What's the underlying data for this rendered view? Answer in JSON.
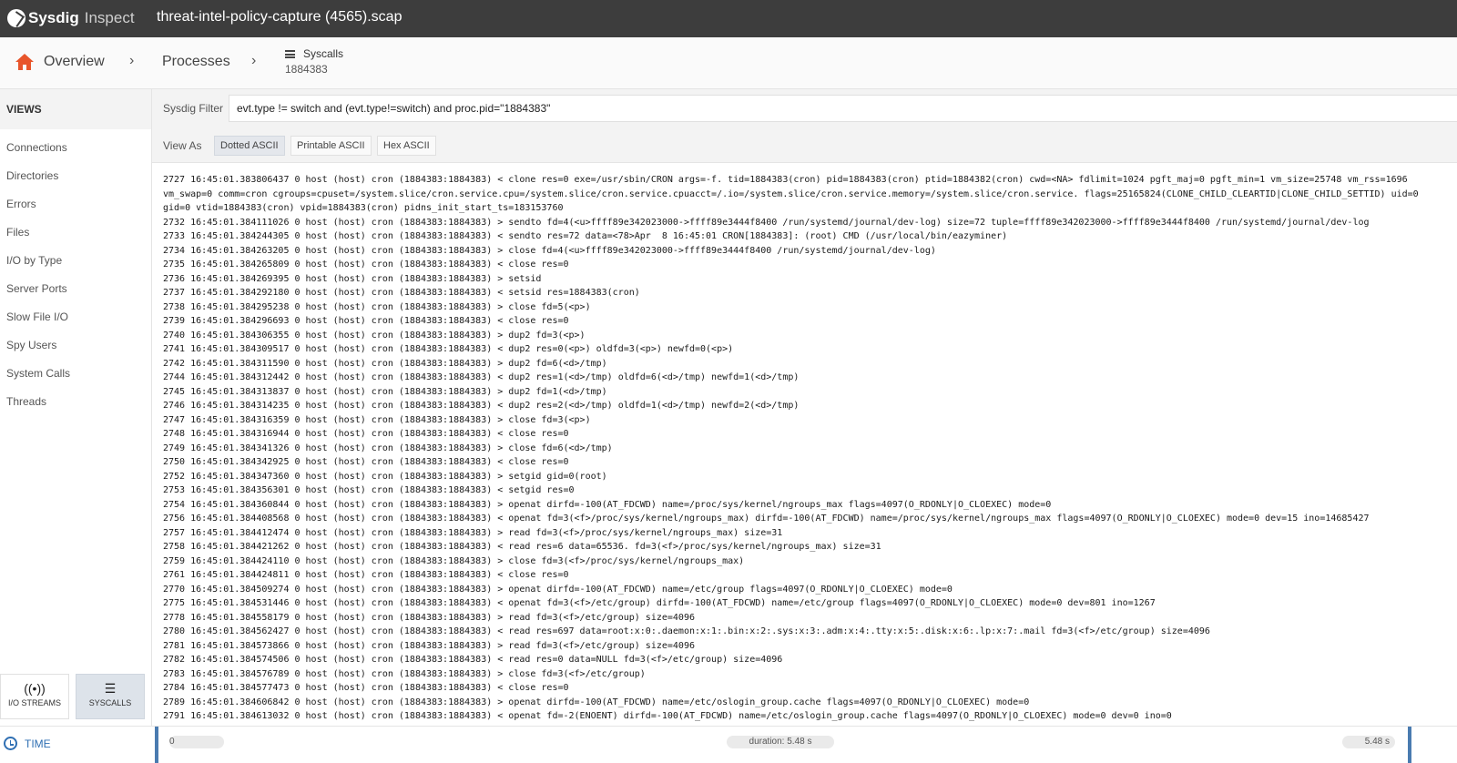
{
  "app": {
    "brand": "Sysdig",
    "product": "Inspect",
    "capture_file": "threat-intel-policy-capture (4565).scap"
  },
  "breadcrumb": {
    "overview": "Overview",
    "processes": "Processes",
    "syscalls": "Syscalls",
    "pid": "1884383"
  },
  "sidebar": {
    "title": "VIEWS",
    "items": [
      "Connections",
      "Directories",
      "Errors",
      "Files",
      "I/O by Type",
      "Server Ports",
      "Slow File I/O",
      "Spy Users",
      "System Calls",
      "Threads"
    ],
    "tabs": [
      {
        "label": "I/O STREAMS",
        "icon": "broadcast-icon"
      },
      {
        "label": "SYSCALLS",
        "icon": "list-icon",
        "active": true
      }
    ]
  },
  "filter": {
    "label": "Sysdig Filter",
    "value": "evt.type != switch and (evt.type!=switch) and proc.pid=\"1884383\""
  },
  "view_as": {
    "label": "View As",
    "options": [
      "Dotted ASCII",
      "Printable ASCII",
      "Hex ASCII"
    ],
    "selected": "Dotted ASCII"
  },
  "log_lines": [
    "2727 16:45:01.383806437 0 host (host) cron (1884383:1884383) < clone res=0 exe=/usr/sbin/CRON args=-f. tid=1884383(cron) pid=1884383(cron) ptid=1884382(cron) cwd=<NA> fdlimit=1024 pgft_maj=0 pgft_min=1 vm_size=25748 vm_rss=1696",
    "vm_swap=0 comm=cron cgroups=cpuset=/system.slice/cron.service.cpu=/system.slice/cron.service.cpuacct=/.io=/system.slice/cron.service.memory=/system.slice/cron.service. flags=25165824(CLONE_CHILD_CLEARTID|CLONE_CHILD_SETTID) uid=0",
    "gid=0 vtid=1884383(cron) vpid=1884383(cron) pidns_init_start_ts=183153760",
    "2732 16:45:01.384111026 0 host (host) cron (1884383:1884383) > sendto fd=4(<u>ffff89e342023000->ffff89e3444f8400 /run/systemd/journal/dev-log) size=72 tuple=ffff89e342023000->ffff89e3444f8400 /run/systemd/journal/dev-log",
    "2733 16:45:01.384244305 0 host (host) cron (1884383:1884383) < sendto res=72 data=<78>Apr  8 16:45:01 CRON[1884383]: (root) CMD (/usr/local/bin/eazyminer)",
    "2734 16:45:01.384263205 0 host (host) cron (1884383:1884383) > close fd=4(<u>ffff89e342023000->ffff89e3444f8400 /run/systemd/journal/dev-log)",
    "2735 16:45:01.384265809 0 host (host) cron (1884383:1884383) < close res=0",
    "2736 16:45:01.384269395 0 host (host) cron (1884383:1884383) > setsid",
    "2737 16:45:01.384292180 0 host (host) cron (1884383:1884383) < setsid res=1884383(cron)",
    "2738 16:45:01.384295238 0 host (host) cron (1884383:1884383) > close fd=5(<p>)",
    "2739 16:45:01.384296693 0 host (host) cron (1884383:1884383) < close res=0",
    "2740 16:45:01.384306355 0 host (host) cron (1884383:1884383) > dup2 fd=3(<p>)",
    "2741 16:45:01.384309517 0 host (host) cron (1884383:1884383) < dup2 res=0(<p>) oldfd=3(<p>) newfd=0(<p>)",
    "2742 16:45:01.384311590 0 host (host) cron (1884383:1884383) > dup2 fd=6(<d>/tmp)",
    "2744 16:45:01.384312442 0 host (host) cron (1884383:1884383) < dup2 res=1(<d>/tmp) oldfd=6(<d>/tmp) newfd=1(<d>/tmp)",
    "2745 16:45:01.384313837 0 host (host) cron (1884383:1884383) > dup2 fd=1(<d>/tmp)",
    "2746 16:45:01.384314235 0 host (host) cron (1884383:1884383) < dup2 res=2(<d>/tmp) oldfd=1(<d>/tmp) newfd=2(<d>/tmp)",
    "2747 16:45:01.384316359 0 host (host) cron (1884383:1884383) > close fd=3(<p>)",
    "2748 16:45:01.384316944 0 host (host) cron (1884383:1884383) < close res=0",
    "2749 16:45:01.384341326 0 host (host) cron (1884383:1884383) > close fd=6(<d>/tmp)",
    "2750 16:45:01.384342925 0 host (host) cron (1884383:1884383) < close res=0",
    "2752 16:45:01.384347360 0 host (host) cron (1884383:1884383) > setgid gid=0(root)",
    "2753 16:45:01.384356301 0 host (host) cron (1884383:1884383) < setgid res=0",
    "2754 16:45:01.384360844 0 host (host) cron (1884383:1884383) > openat dirfd=-100(AT_FDCWD) name=/proc/sys/kernel/ngroups_max flags=4097(O_RDONLY|O_CLOEXEC) mode=0",
    "2756 16:45:01.384408568 0 host (host) cron (1884383:1884383) < openat fd=3(<f>/proc/sys/kernel/ngroups_max) dirfd=-100(AT_FDCWD) name=/proc/sys/kernel/ngroups_max flags=4097(O_RDONLY|O_CLOEXEC) mode=0 dev=15 ino=14685427",
    "2757 16:45:01.384412474 0 host (host) cron (1884383:1884383) > read fd=3(<f>/proc/sys/kernel/ngroups_max) size=31",
    "2758 16:45:01.384421262 0 host (host) cron (1884383:1884383) < read res=6 data=65536. fd=3(<f>/proc/sys/kernel/ngroups_max) size=31",
    "2759 16:45:01.384424110 0 host (host) cron (1884383:1884383) > close fd=3(<f>/proc/sys/kernel/ngroups_max)",
    "2761 16:45:01.384424811 0 host (host) cron (1884383:1884383) < close res=0",
    "2770 16:45:01.384509274 0 host (host) cron (1884383:1884383) > openat dirfd=-100(AT_FDCWD) name=/etc/group flags=4097(O_RDONLY|O_CLOEXEC) mode=0",
    "2775 16:45:01.384531446 0 host (host) cron (1884383:1884383) < openat fd=3(<f>/etc/group) dirfd=-100(AT_FDCWD) name=/etc/group flags=4097(O_RDONLY|O_CLOEXEC) mode=0 dev=801 ino=1267",
    "2778 16:45:01.384558179 0 host (host) cron (1884383:1884383) > read fd=3(<f>/etc/group) size=4096",
    "2780 16:45:01.384562427 0 host (host) cron (1884383:1884383) < read res=697 data=root:x:0:.daemon:x:1:.bin:x:2:.sys:x:3:.adm:x:4:.tty:x:5:.disk:x:6:.lp:x:7:.mail fd=3(<f>/etc/group) size=4096",
    "2781 16:45:01.384573866 0 host (host) cron (1884383:1884383) > read fd=3(<f>/etc/group) size=4096",
    "2782 16:45:01.384574506 0 host (host) cron (1884383:1884383) < read res=0 data=NULL fd=3(<f>/etc/group) size=4096",
    "2783 16:45:01.384576789 0 host (host) cron (1884383:1884383) > close fd=3(<f>/etc/group)",
    "2784 16:45:01.384577473 0 host (host) cron (1884383:1884383) < close res=0",
    "2789 16:45:01.384606842 0 host (host) cron (1884383:1884383) > openat dirfd=-100(AT_FDCWD) name=/etc/oslogin_group.cache flags=4097(O_RDONLY|O_CLOEXEC) mode=0",
    "2791 16:45:01.384613032 0 host (host) cron (1884383:1884383) < openat fd=-2(ENOENT) dirfd=-100(AT_FDCWD) name=/etc/oslogin_group.cache flags=4097(O_RDONLY|O_CLOEXEC) mode=0 dev=0 ino=0"
  ],
  "timeline": {
    "label": "TIME",
    "start": "0",
    "duration": "duration: 5.48 s",
    "end": "5.48 s"
  },
  "colors": {
    "topbar": "#3d3d3d",
    "home": "#e8552b",
    "accent": "#2f6fb3"
  }
}
